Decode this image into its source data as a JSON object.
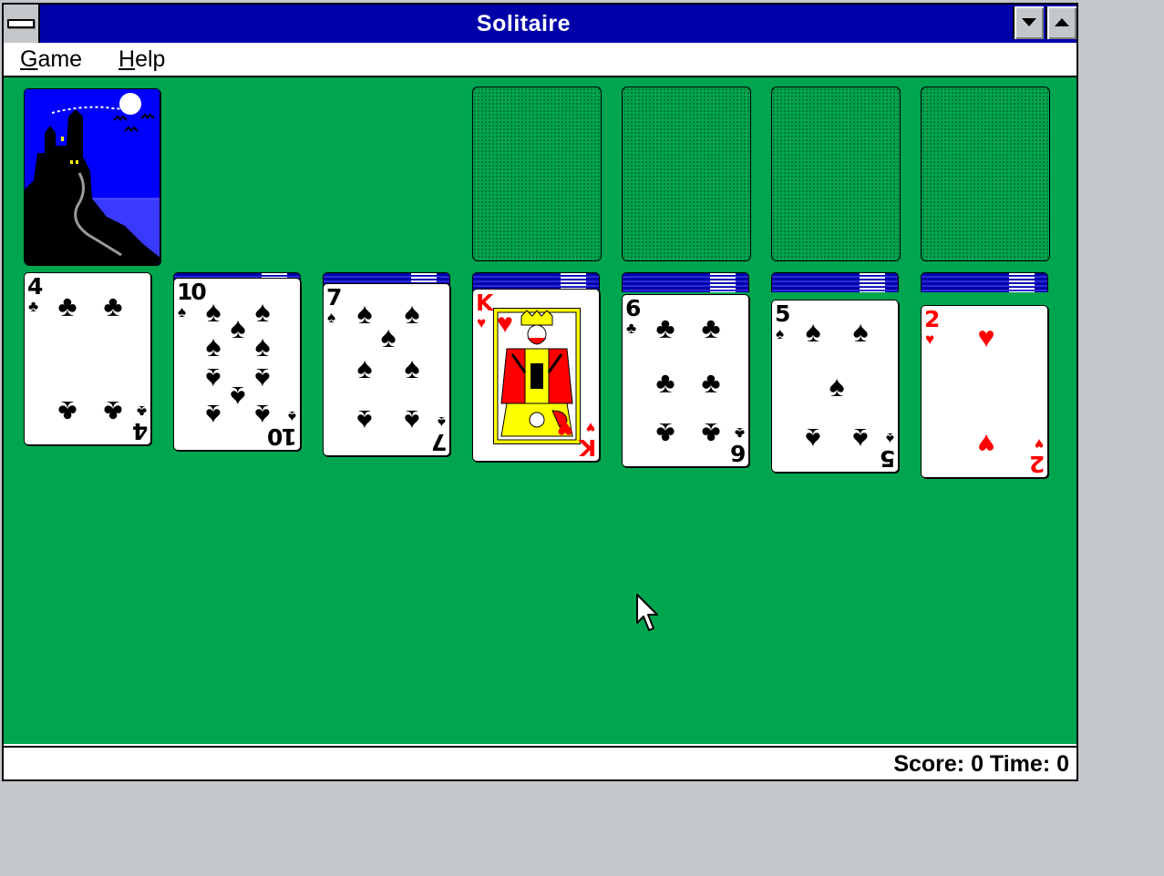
{
  "window": {
    "title": "Solitaire"
  },
  "menu": {
    "items": [
      {
        "key": "G",
        "rest": "ame"
      },
      {
        "key": "H",
        "rest": "elp"
      }
    ]
  },
  "status": {
    "text": "Score: 0 Time: 0"
  },
  "stock": {
    "card_back": "castle-back"
  },
  "foundations": [
    {
      "state": "empty"
    },
    {
      "state": "empty"
    },
    {
      "state": "empty"
    },
    {
      "state": "empty"
    }
  ],
  "tableau": [
    {
      "hidden": 0,
      "top": {
        "rank": "4",
        "suit": "♣",
        "color": "black"
      }
    },
    {
      "hidden": 1,
      "top": {
        "rank": "10",
        "suit": "♠",
        "color": "black"
      }
    },
    {
      "hidden": 2,
      "top": {
        "rank": "7",
        "suit": "♠",
        "color": "black"
      }
    },
    {
      "hidden": 3,
      "top": {
        "rank": "K",
        "suit": "♥",
        "color": "red"
      }
    },
    {
      "hidden": 4,
      "top": {
        "rank": "6",
        "suit": "♣",
        "color": "black"
      }
    },
    {
      "hidden": 5,
      "top": {
        "rank": "5",
        "suit": "♠",
        "color": "black"
      }
    },
    {
      "hidden": 6,
      "top": {
        "rank": "2",
        "suit": "♥",
        "color": "red"
      }
    }
  ],
  "colors": {
    "felt": "#00a550",
    "titlebar": "#0000a8",
    "desktop": "#c3c7cb",
    "red": "#ff0000"
  }
}
